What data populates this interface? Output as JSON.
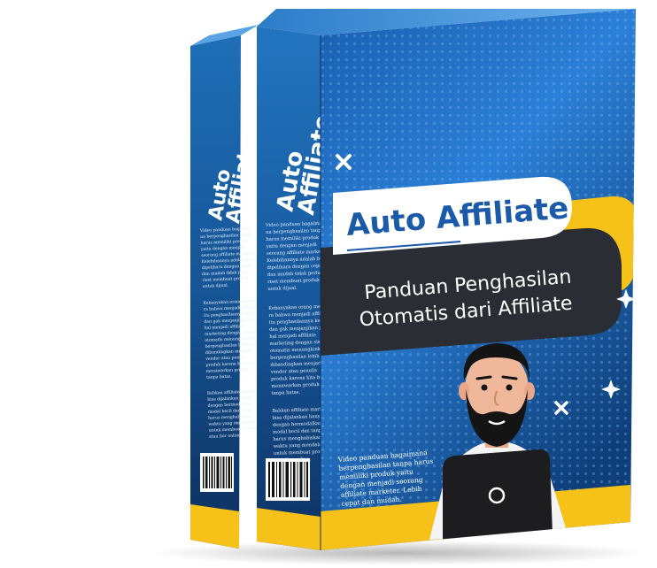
{
  "product": {
    "title_line1": "Auto",
    "title_line2": "Affiliate",
    "banner_title": "Auto Affiliate",
    "subtitle_line1": "Panduan Penghasilan",
    "subtitle_line2": "Otomatis dari Affiliate",
    "front_description": [
      "Video panduan bagaimana",
      "berpenghasilan tanpa harus",
      "memiliki produk yaitu",
      "dengan menjadi seorang",
      "affiliate marketer. Lebih",
      "cepat dan mudah."
    ],
    "side_paragraph_1": [
      "Video panduan bagaima-",
      "na berpenghasilan tanpa",
      "harus memiliki produk",
      "yaitu dengan menjadi",
      "seorang affiliate marketer.",
      "Kelebihannya adalah bisa",
      "dipelihara dengan cepat",
      "dan mudah tidak perlu",
      "riset membuat produk",
      "untuk dijual."
    ],
    "side_paragraph_2": [
      "Kebanyakan orang mengi-",
      "ra bahwa menjadi affiliate",
      "itu penghasilannya kecil",
      "dan gak menjanjikan pada-",
      "hal menjadi affiliate",
      "marketing dengan sistem",
      "otomatis menungkinkan",
      "berpenghasilan lebih besar",
      "dibandingkan menjadi",
      "vendor atau penulis",
      "produk karena kita bisa",
      "menawarkan produk",
      "tanpa batas."
    ],
    "side_paragraph_3": [
      "Bahkan affiliate marketing",
      "bisa dijalankan hanya",
      "dengan bermodalkan",
      "modal kecil dan tanpa",
      "harus menghabiskan",
      "waktu yang mendalam",
      "untuk membuat produk",
      "atau liur online."
    ]
  },
  "colors": {
    "front_dark": "#0d3566",
    "front_mid": "#1f6fc4",
    "front_light": "#3a93e8",
    "side_dark": "#0b2a52",
    "side_mid": "#1a5fa8",
    "yellow": "#f6c21a",
    "banner_dark": "#2a2d33",
    "beard": "#141414",
    "skin": "#f0b89a",
    "shirt": "#f4f4f4",
    "laptop": "#1d1d1f"
  },
  "icons": [
    "sparkle-icon",
    "cross-icon",
    "barcode-icon",
    "laptop-icon"
  ]
}
